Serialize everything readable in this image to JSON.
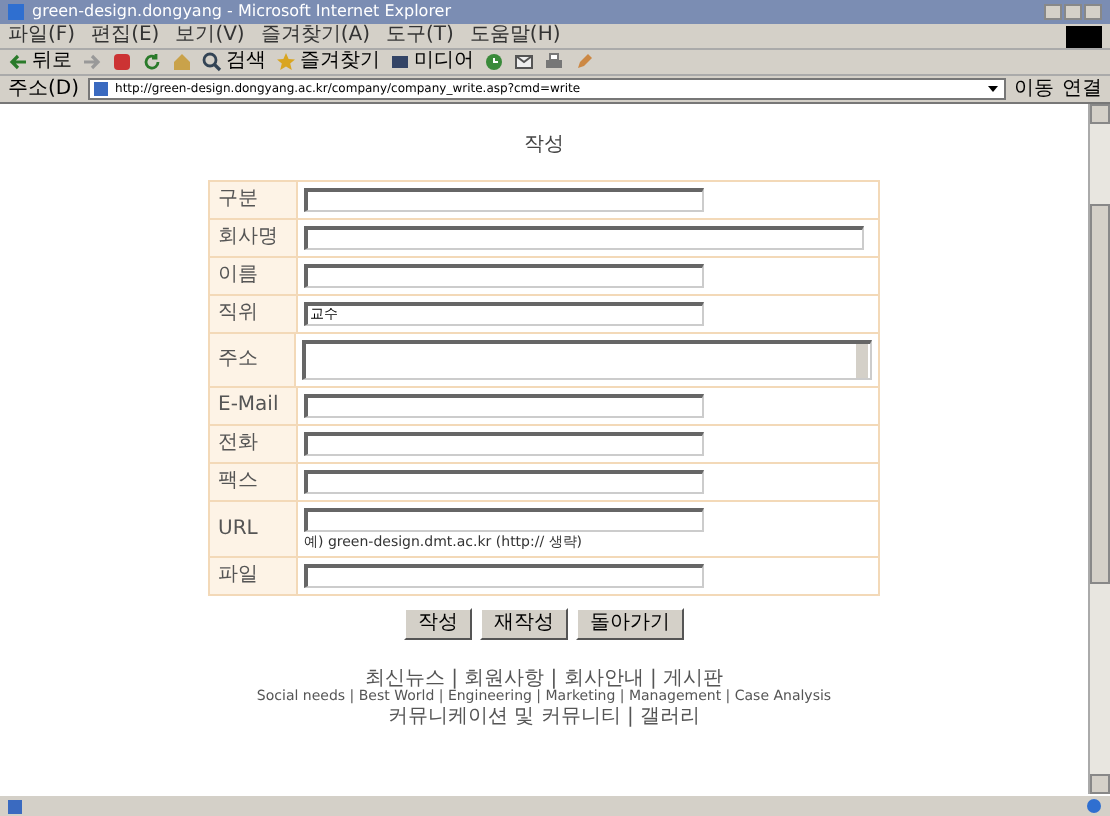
{
  "window": {
    "title": "green-design.dongyang - Microsoft Internet Explorer"
  },
  "menu": [
    "파일(F)",
    "편집(E)",
    "보기(V)",
    "즐겨찾기(A)",
    "도구(T)",
    "도움말(H)"
  ],
  "toolbar": [
    {
      "kind": "back",
      "label": "뒤로"
    },
    {
      "kind": "forward"
    },
    {
      "kind": "stop"
    },
    {
      "kind": "refresh"
    },
    {
      "kind": "home"
    },
    {
      "kind": "search",
      "label": "검색"
    },
    {
      "kind": "favorites",
      "label": "즐겨찾기"
    },
    {
      "kind": "media",
      "label": "미디어"
    },
    {
      "kind": "history"
    },
    {
      "kind": "mail"
    },
    {
      "kind": "print"
    },
    {
      "kind": "edit"
    }
  ],
  "address_bar": {
    "label": "주소(D)",
    "url": "http://green-design.dongyang.ac.kr/company/company_write.asp?cmd=write",
    "go": "이동",
    "links": "연결"
  },
  "page_title": "작성",
  "form": [
    {
      "label": "구분",
      "kind": "text"
    },
    {
      "label": "회사명",
      "kind": "wide"
    },
    {
      "label": "이름",
      "kind": "text"
    },
    {
      "label": "직위",
      "kind": "text",
      "value": "교수"
    },
    {
      "label": "주소",
      "kind": "textarea"
    },
    {
      "label": "E-Mail",
      "kind": "text"
    },
    {
      "label": "전화",
      "kind": "text"
    },
    {
      "label": "팩스",
      "kind": "text"
    },
    {
      "label": "URL",
      "kind": "text",
      "note": "예) green-design.dmt.ac.kr (http:// 생략)"
    },
    {
      "label": "파일",
      "kind": "text"
    }
  ],
  "buttons": [
    "작성",
    "재작성",
    "돌아가기"
  ],
  "footer": [
    "최신뉴스 | 회원사항 | 회사안내 | 게시판",
    "Social needs | Best World | Engineering | Marketing | Management | Case Analysis",
    "커뮤니케이션 및 커뮤니티 | 갤러리"
  ]
}
